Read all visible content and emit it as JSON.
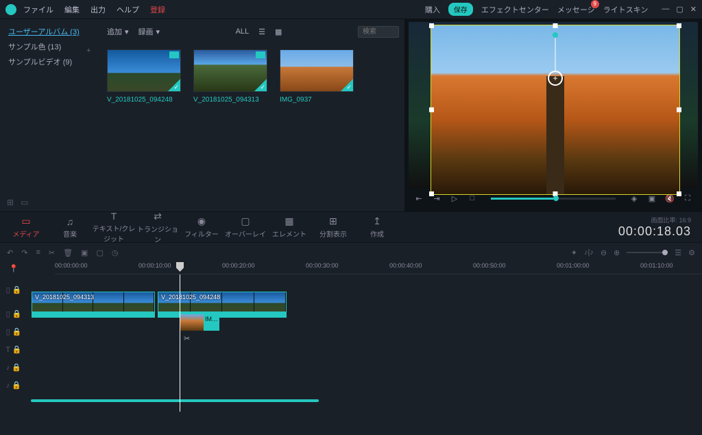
{
  "menu": {
    "file": "ファイル",
    "edit": "編集",
    "output": "出力",
    "help": "ヘルプ",
    "register": "登録"
  },
  "topright": {
    "buy": "購入",
    "save": "保存",
    "fx": "エフェクトセンター",
    "msg": "メッセージ",
    "msg_count": "9",
    "skin": "ライトスキン"
  },
  "sidebar": {
    "album": "ユーザーアルバム (3)",
    "sample_color": "サンプル色 (13)",
    "sample_video": "サンプルビデオ (9)"
  },
  "media_tools": {
    "add": "追加",
    "record": "録画",
    "all": "ALL",
    "search_ph": "検索"
  },
  "thumbs": [
    {
      "label": "V_20181025_094248"
    },
    {
      "label": "V_20181025_094313"
    },
    {
      "label": "IMG_0937"
    }
  ],
  "tabs": {
    "media": "メディア",
    "music": "音楽",
    "text": "テキスト/クレジット",
    "transition": "トランジション",
    "filter": "フィルター",
    "overlay": "オーバーレイ",
    "element": "エレメント",
    "split": "分割表示",
    "create": "作成"
  },
  "aspect": {
    "label": "画面比率: 16:9",
    "timecode": "00:00:18.03"
  },
  "ruler": [
    "00:00:00:00",
    "00:00:10:00",
    "00:00:20:00",
    "00:00:30:00",
    "00:00:40:00",
    "00:00:50:00",
    "00:01:00:00",
    "00:01:10:00"
  ],
  "clips": {
    "c1": "V_20181025_094313",
    "c2": "V_20181025_094248",
    "c3": "IM…"
  }
}
